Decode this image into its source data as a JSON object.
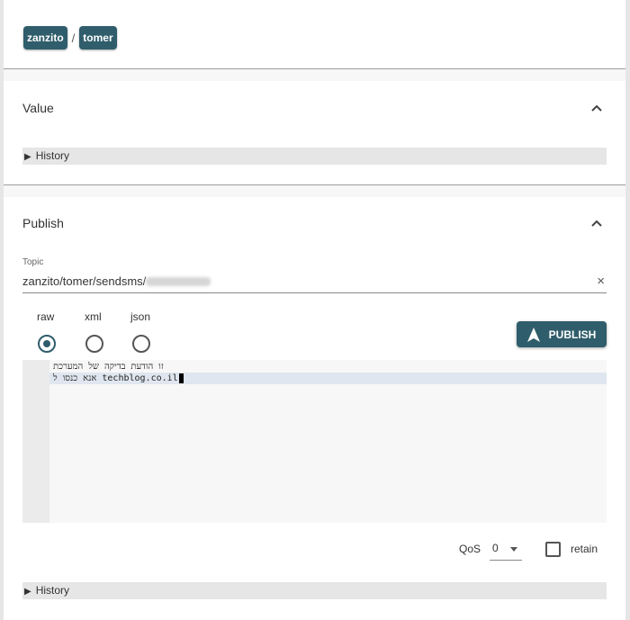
{
  "breadcrumb": {
    "items": [
      {
        "label": "zanzito"
      },
      {
        "label": "tomer"
      }
    ],
    "separator": "/"
  },
  "value_panel": {
    "title": "Value",
    "history_label": "History"
  },
  "publish_panel": {
    "title": "Publish",
    "topic": {
      "label": "Topic",
      "value": "zanzito/tomer/sendsms/",
      "clear_icon": "×"
    },
    "formats": [
      {
        "label": "raw",
        "selected": true
      },
      {
        "label": "xml",
        "selected": false
      },
      {
        "label": "json",
        "selected": false
      }
    ],
    "publish_button": {
      "label": "PUBLISH",
      "icon": "navigation-arrow-icon"
    },
    "editor": {
      "lines": [
        "זו הודעת בדיקה של המערכת",
        "אנא כנסו ל techblog.co.il"
      ]
    },
    "qos": {
      "label": "QoS",
      "value": "0"
    },
    "retain": {
      "label": "retain",
      "checked": false
    },
    "history_label": "History"
  },
  "colors": {
    "accent": "#2f5d6b",
    "history_bar": "#e6e6e6",
    "editor_bg": "#f7f7f7",
    "active_line": "#dfe6ef"
  }
}
